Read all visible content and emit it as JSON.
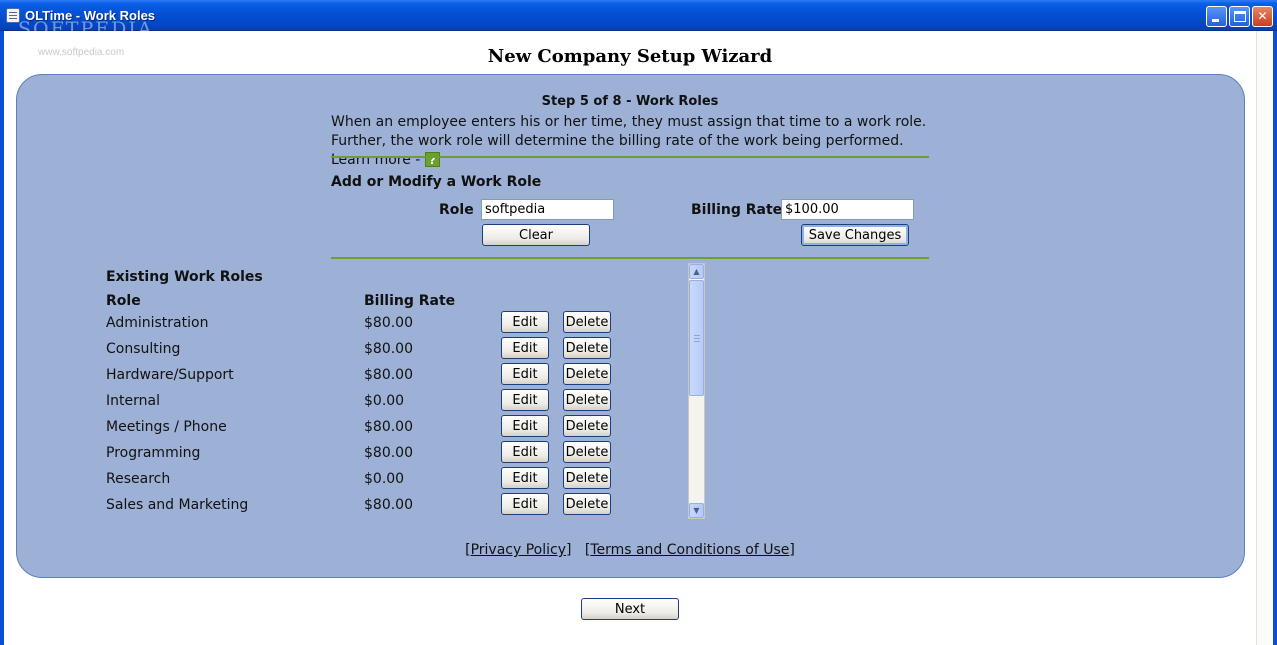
{
  "window": {
    "title": "OLTime - Work Roles",
    "watermark": "SOFTPEDIA",
    "watermark_sub": "www.softpedia.com",
    "minimize_label": "minimize",
    "maximize_label": "maximize",
    "close_label": "✕"
  },
  "wizard": {
    "title": "New Company Setup Wizard",
    "step_title": "Step 5 of 8 - Work Roles",
    "description": "When an employee enters his or her time, they must assign that time to a work role.  Further, the work role will determine the billing rate of the work being performed.  Learn more - ",
    "help_icon": "?"
  },
  "form": {
    "section_title": "Add or Modify a Work Role",
    "role_label": "Role",
    "role_value": "softpedia",
    "billing_rate_label": "Billing Rate",
    "billing_rate_value": "$100.00",
    "clear_label": "Clear",
    "save_label": "Save Changes"
  },
  "roles": {
    "section_title": "Existing Work Roles",
    "col_role": "Role",
    "col_rate": "Billing Rate",
    "edit_label": "Edit",
    "delete_label": "Delete",
    "items": [
      {
        "role": "Administration",
        "rate": "$80.00"
      },
      {
        "role": "Consulting",
        "rate": "$80.00"
      },
      {
        "role": "Hardware/Support",
        "rate": "$80.00"
      },
      {
        "role": "Internal",
        "rate": "$0.00"
      },
      {
        "role": "Meetings / Phone",
        "rate": "$80.00"
      },
      {
        "role": "Programming",
        "rate": "$80.00"
      },
      {
        "role": "Research",
        "rate": "$0.00"
      },
      {
        "role": "Sales and Marketing",
        "rate": "$80.00"
      }
    ]
  },
  "footer": {
    "privacy_link": "Privacy Policy",
    "terms_link": "Terms and Conditions of Use"
  },
  "nav": {
    "next_label": "Next"
  },
  "colors": {
    "panel_background": "#9db1d6",
    "divider": "#6e9d32",
    "titlebar": "#0452d6"
  }
}
